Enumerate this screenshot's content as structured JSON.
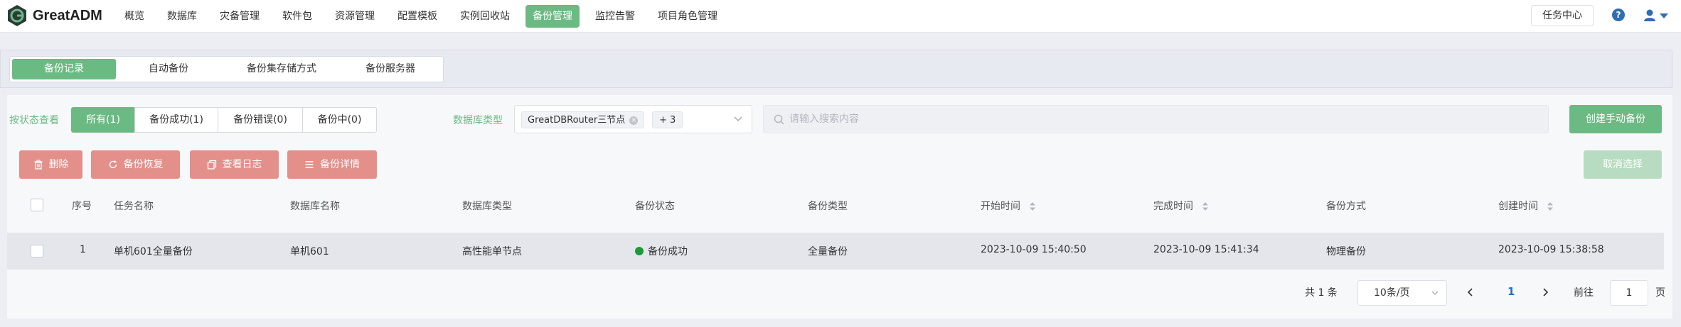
{
  "app": {
    "name": "GreatADM"
  },
  "nav": {
    "items": [
      "概览",
      "数据库",
      "灾备管理",
      "软件包",
      "资源管理",
      "配置模板",
      "实例回收站",
      "备份管理",
      "监控告警",
      "项目角色管理"
    ],
    "active": "备份管理"
  },
  "header": {
    "task_center": "任务中心"
  },
  "tabs": {
    "items": [
      "备份记录",
      "自动备份",
      "备份集存储方式",
      "备份服务器"
    ],
    "active": "备份记录"
  },
  "filter": {
    "status_label": "按状态查看",
    "status_options": [
      "所有(1)",
      "备份成功(1)",
      "备份错误(0)",
      "备份中(0)"
    ],
    "status_active": "所有(1)",
    "dbtype_label": "数据库类型",
    "dbtype_chip": "GreatDBRouter三节点",
    "dbtype_more": "+ 3",
    "search_placeholder": "请输入搜索内容",
    "search_value": ""
  },
  "actions": {
    "create": "创建手动备份",
    "delete": "删除",
    "restore": "备份恢复",
    "log": "查看日志",
    "detail": "备份详情",
    "cancel_selection": "取消选择"
  },
  "table": {
    "columns": [
      "序号",
      "任务名称",
      "数据库名称",
      "数据库类型",
      "备份状态",
      "备份类型",
      "开始时间",
      "完成时间",
      "备份方式",
      "创建时间"
    ],
    "rows": [
      {
        "index": "1",
        "task_name": "单机601全量备份",
        "db_name": "单机601",
        "db_type": "高性能单节点",
        "status": "备份成功",
        "backup_type": "全量备份",
        "start_time": "2023-10-09 15:40:50",
        "finish_time": "2023-10-09 15:41:34",
        "method": "物理备份",
        "created_time": "2023-10-09 15:38:58"
      }
    ]
  },
  "pagination": {
    "total": "共 1 条",
    "page_size": "10条/页",
    "current": "1",
    "goto_label": "前往",
    "goto_value": "1",
    "page_unit": "页"
  },
  "colors": {
    "accent": "#6bba83",
    "danger": "#e38f8a",
    "success_dot": "#1c9a3a",
    "link": "#2f6db4"
  }
}
